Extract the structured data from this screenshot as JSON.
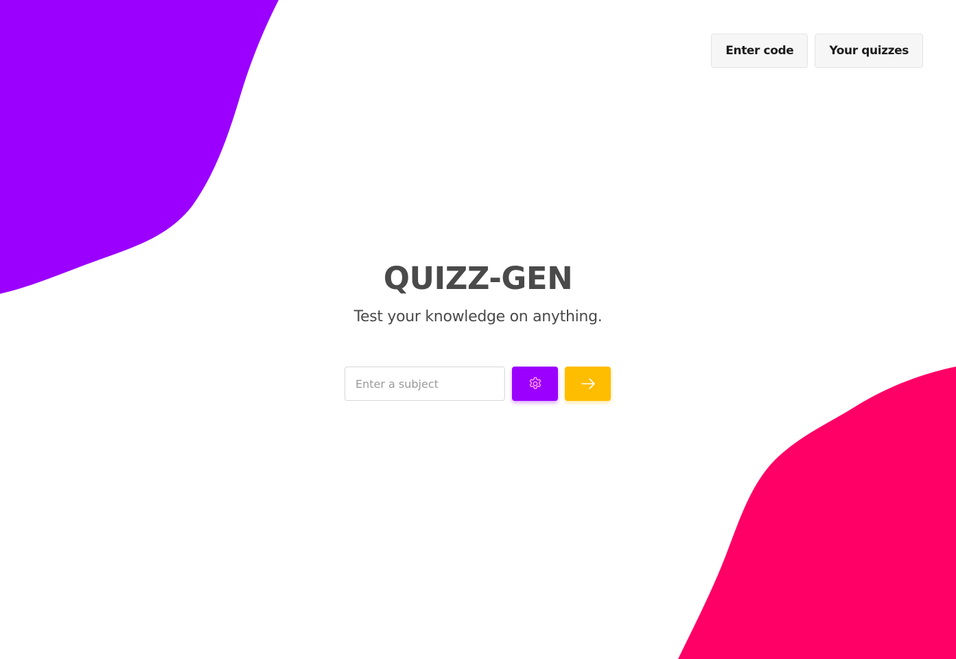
{
  "colors": {
    "purple_blob": "#9b00ff",
    "pink_blob": "#ff0066",
    "settings_button": "#9b00ff",
    "go_button": "#ffbd00",
    "text": "#4a4a4a"
  },
  "nav": {
    "enter_code_label": "Enter code",
    "your_quizzes_label": "Your quizzes"
  },
  "hero": {
    "title": "QUIZZ-GEN",
    "subtitle": "Test your knowledge on anything."
  },
  "form": {
    "subject_placeholder": "Enter a subject",
    "subject_value": "",
    "settings_icon": "gear-icon",
    "submit_icon": "arrow-right-icon"
  }
}
